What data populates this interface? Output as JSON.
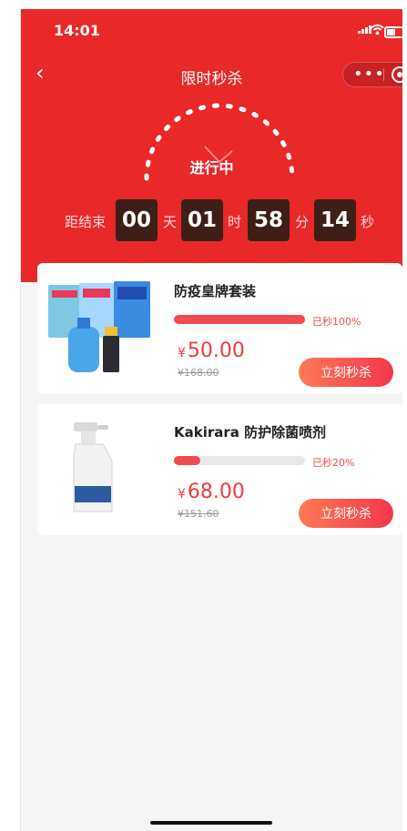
{
  "status_bar": {
    "time": "14:01"
  },
  "nav": {
    "title": "限时秒杀",
    "back_icon": "chevron-left-icon",
    "more_icon": "more-dots-icon",
    "close_icon": "target-close-icon"
  },
  "flash_sale": {
    "status": "进行中",
    "countdown": {
      "prefix": "距结束",
      "days": "00",
      "days_unit": "天",
      "hours": "01",
      "hours_unit": "时",
      "minutes": "58",
      "minutes_unit": "分",
      "seconds": "14",
      "seconds_unit": "秒"
    }
  },
  "products": [
    {
      "name": "防疫皇牌套装",
      "sold_label": "已秒100%",
      "progress": 1.0,
      "currency": "¥",
      "price": "50.00",
      "original_price": "¥168.00",
      "button": "立刻秒杀"
    },
    {
      "name": "Kakirara 防护除菌喷剂",
      "sold_label": "已秒20%",
      "progress": 0.2,
      "currency": "¥",
      "price": "68.00",
      "original_price": "¥151.60",
      "button": "立刻秒杀"
    }
  ],
  "colors": {
    "primary_red": "#e9282a",
    "price_red": "#ef3a3e",
    "timer_box": "#3d1f17"
  }
}
